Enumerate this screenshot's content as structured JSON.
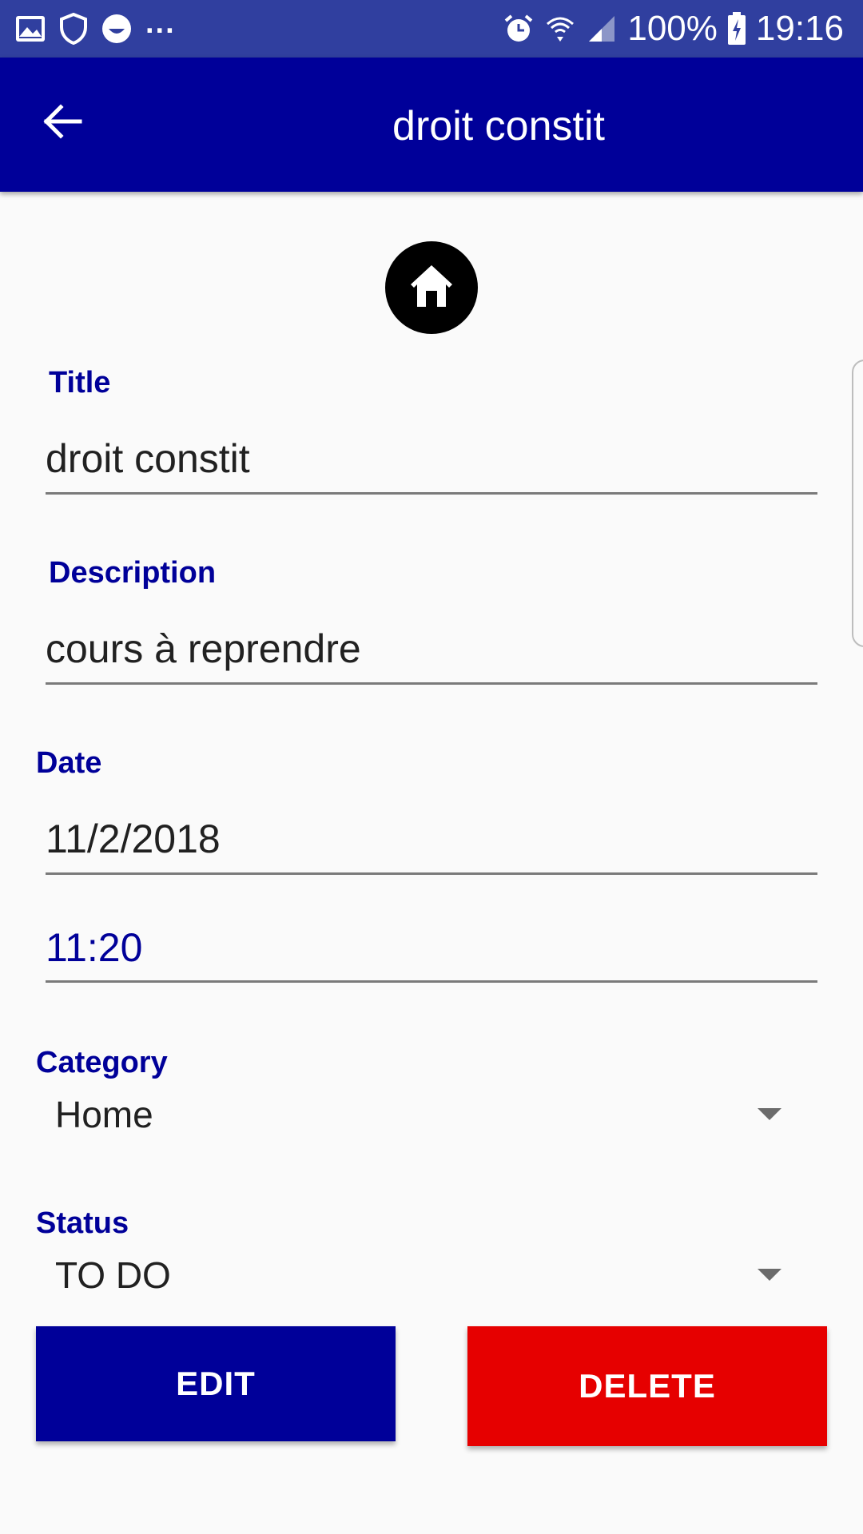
{
  "status_bar": {
    "left_icons": [
      "gallery-icon",
      "shield-icon",
      "smiley-icon"
    ],
    "more_label": "...",
    "right_icons": [
      "alarm-icon",
      "wifi-icon",
      "signal-icon",
      "battery-charging-icon"
    ],
    "battery": "100%",
    "time": "19:16"
  },
  "app_bar": {
    "title": "droit constit",
    "back_icon": "arrow-back-icon",
    "color": "#000099"
  },
  "category_icon": "home-icon",
  "form": {
    "title_label": "Title",
    "title_value": "droit constit",
    "description_label": "Description",
    "description_value": "cours à reprendre",
    "date_label": "Date",
    "date_value": "11/2/2018",
    "time_value": "11:20",
    "category_label": "Category",
    "category_value": "Home",
    "status_label": "Status",
    "status_value": "TO DO"
  },
  "buttons": {
    "edit_label": "EDIT",
    "edit_color": "#000099",
    "delete_label": "DELETE",
    "delete_color": "#e60000"
  }
}
